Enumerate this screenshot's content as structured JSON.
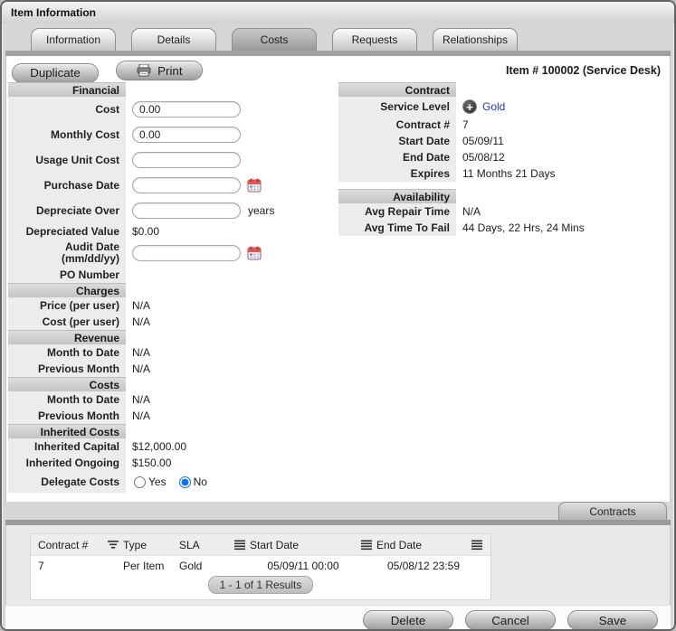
{
  "window": {
    "title": "Item Information",
    "item_ref": "Item # 100002 (Service Desk)"
  },
  "tabs": [
    {
      "label": "Information",
      "active": false
    },
    {
      "label": "Details",
      "active": false
    },
    {
      "label": "Costs",
      "active": true
    },
    {
      "label": "Requests",
      "active": false
    },
    {
      "label": "Relationships",
      "active": false
    }
  ],
  "toolbar": {
    "duplicate_label": "Duplicate",
    "print_label": "Print"
  },
  "financial": {
    "title": "Financial",
    "cost": {
      "label": "Cost",
      "value": "0.00"
    },
    "monthly_cost": {
      "label": "Monthly Cost",
      "value": "0.00"
    },
    "usage_unit_cost": {
      "label": "Usage Unit Cost",
      "value": ""
    },
    "purchase_date": {
      "label": "Purchase Date",
      "value": ""
    },
    "depreciate_over": {
      "label": "Depreciate Over",
      "value": "",
      "suffix": "years"
    },
    "depreciated_value": {
      "label": "Depreciated Value",
      "value": "$0.00"
    },
    "audit_date": {
      "label": "Audit Date",
      "sublabel": "(mm/dd/yy)",
      "value": ""
    },
    "po_number": {
      "label": "PO Number",
      "value": ""
    }
  },
  "charges": {
    "title": "Charges",
    "rows": [
      {
        "label": "Price (per user)",
        "value": "N/A"
      },
      {
        "label": "Cost (per user)",
        "value": "N/A"
      }
    ]
  },
  "revenue": {
    "title": "Revenue",
    "rows": [
      {
        "label": "Month to Date",
        "value": "N/A"
      },
      {
        "label": "Previous Month",
        "value": "N/A"
      }
    ]
  },
  "costs": {
    "title": "Costs",
    "rows": [
      {
        "label": "Month to Date",
        "value": "N/A"
      },
      {
        "label": "Previous Month",
        "value": "N/A"
      }
    ]
  },
  "inherited_costs": {
    "title": "Inherited Costs",
    "rows": [
      {
        "label": "Inherited Capital",
        "value": "$12,000.00"
      },
      {
        "label": "Inherited Ongoing",
        "value": "$150.00"
      }
    ],
    "delegate_costs": {
      "label": "Delegate Costs",
      "yes_label": "Yes",
      "no_label": "No",
      "yes_checked": false,
      "no_checked": true
    }
  },
  "contract": {
    "title": "Contract",
    "service_level": {
      "label": "Service Level",
      "value": "Gold"
    },
    "rows": [
      {
        "label": "Contract #",
        "value": "7"
      },
      {
        "label": "Start Date",
        "value": "05/09/11"
      },
      {
        "label": "End Date",
        "value": "05/08/12"
      },
      {
        "label": "Expires",
        "value": "11 Months 21 Days"
      }
    ]
  },
  "availability": {
    "title": "Availability",
    "rows": [
      {
        "label": "Avg Repair Time",
        "value": "N/A"
      },
      {
        "label": "Avg Time To Fail",
        "value": "44 Days, 22 Hrs, 24 Mins"
      }
    ]
  },
  "contracts_panel": {
    "tab_label": "Contracts",
    "table": {
      "columns": [
        "Contract #",
        "Type",
        "SLA",
        "Start Date",
        "End Date"
      ],
      "rows": [
        [
          "7",
          "Per Item",
          "Gold",
          "05/09/11 00:00",
          "05/08/12 23:59"
        ]
      ],
      "pagination": "1 - 1 of 1 Results"
    }
  },
  "footer": {
    "delete_label": "Delete",
    "cancel_label": "Cancel",
    "save_label": "Save"
  },
  "colors": {
    "link": "#2233cc",
    "calendar_red": "#e8564e",
    "service_level_icon": "#3b3b3b"
  }
}
